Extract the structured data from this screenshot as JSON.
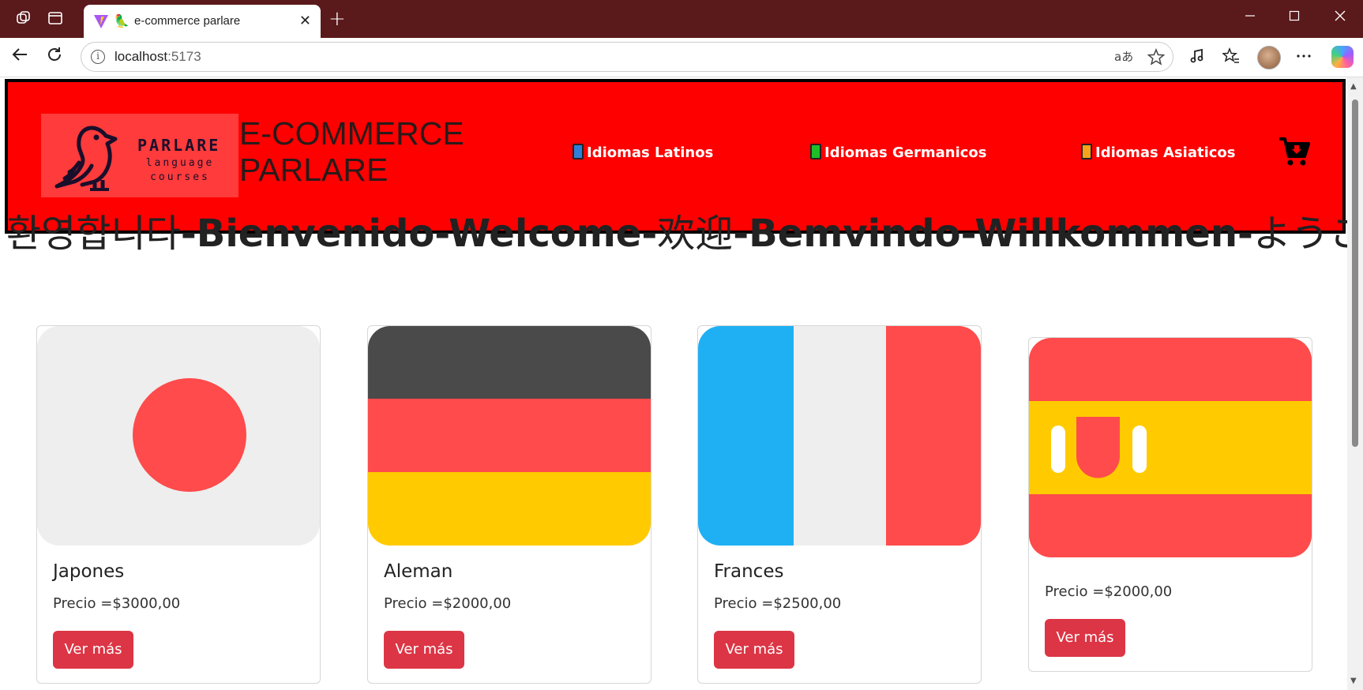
{
  "browser": {
    "tab_title": "e-commerce parlare",
    "url_host": "localhost",
    "url_port": ":5173",
    "new_tab_symbol": "+",
    "close_symbol": "✕",
    "read_aloud_symbol": "aあ"
  },
  "header": {
    "logo_word": "PARLARE",
    "logo_sub_1": "language",
    "logo_sub_2": "courses",
    "brand_line_1": "E-COMMERCE",
    "brand_line_2": "PARLARE",
    "nav": [
      {
        "label": "Idiomas Latinos",
        "book_color": "#2f7fd8"
      },
      {
        "label": "Idiomas Germanicos",
        "book_color": "#1fbf2a"
      },
      {
        "label": "Idiomas Asiaticos",
        "book_color": "#f5a31a"
      }
    ],
    "cart_icon": "cart-download-icon"
  },
  "welcome": {
    "part_1": "환영합니다",
    "part_2": "-Bienvenido-Welcome-",
    "part_3": "欢迎",
    "part_4": "-Bemvindo-Willkommen-",
    "part_5": "ようこそ"
  },
  "products": [
    {
      "title": "Japones",
      "price": "Precio =$3000,00",
      "button": "Ver más",
      "flag": "japan"
    },
    {
      "title": "Aleman",
      "price": "Precio =$2000,00",
      "button": "Ver más",
      "flag": "germany"
    },
    {
      "title": "Frances",
      "price": "Precio =$2500,00",
      "button": "Ver más",
      "flag": "france"
    },
    {
      "title": "",
      "price": "Precio =$2000,00",
      "button": "Ver más",
      "flag": "spain"
    }
  ],
  "colors": {
    "header_bg": "#ff0000",
    "button_bg": "#dc3545",
    "titlebar_bg": "#5a191b"
  }
}
